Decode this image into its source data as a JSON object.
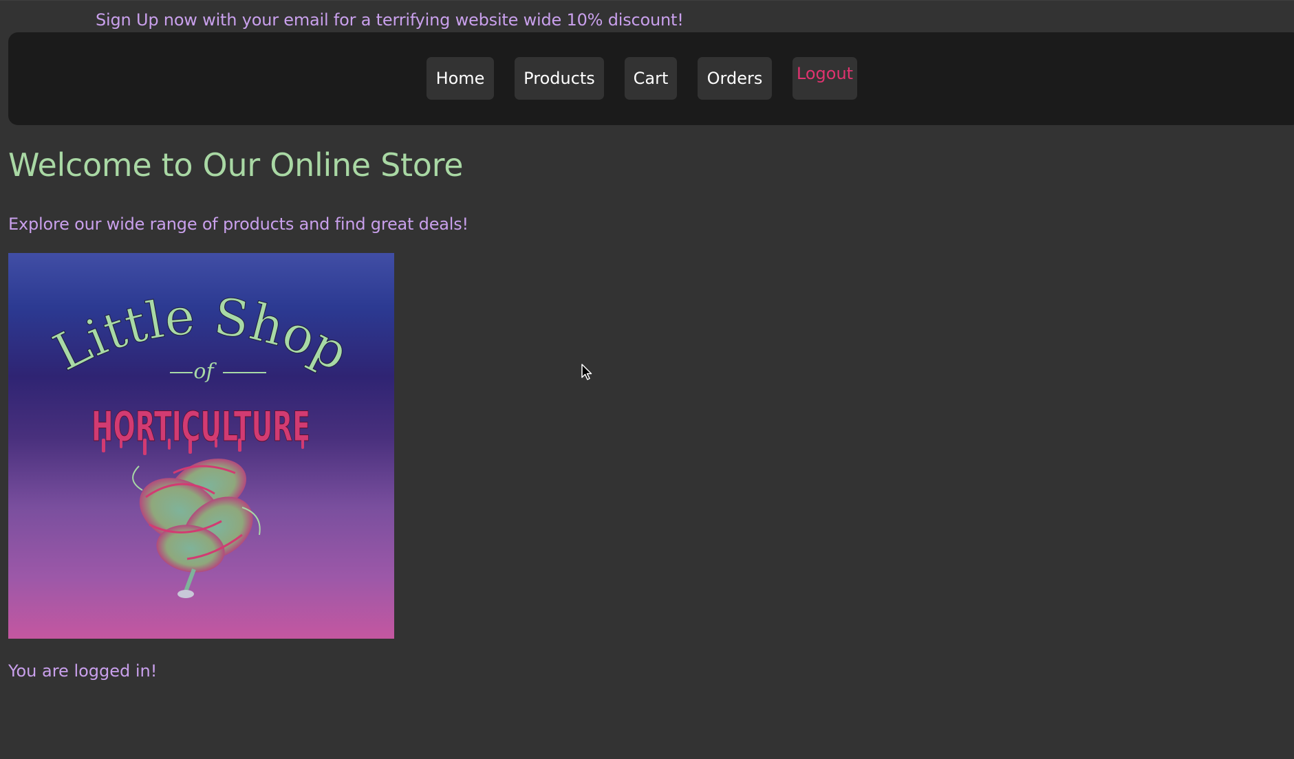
{
  "banner": {
    "text": "Sign Up now with your email for a terrifying website wide 10% discount!"
  },
  "nav": {
    "home": "Home",
    "products": "Products",
    "cart": "Cart",
    "orders": "Orders",
    "logout": "Logout"
  },
  "main": {
    "title": "Welcome to Our Online Store",
    "subtitle": "Explore our wide range of products and find great deals!",
    "status": "You are logged in!"
  },
  "logo": {
    "line1": "Little Shop",
    "line2": "of",
    "line3": "HORTICULTURE",
    "icon": "venus-flytrap-logo"
  },
  "colors": {
    "background": "#333333",
    "navbar": "#1b1b1b",
    "nav_button": "#333333",
    "title_green": "#a9d8a4",
    "text_purple": "#c9a0ec",
    "logout_pink": "#e0336f"
  }
}
